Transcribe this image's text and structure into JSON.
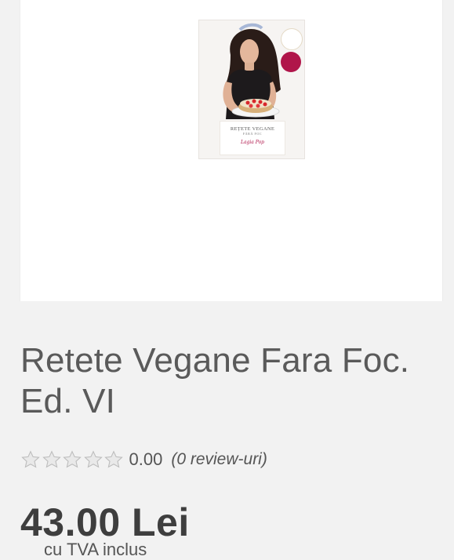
{
  "product": {
    "image": {
      "cover_title": "REȚETE VEGANE",
      "cover_subtitle": "FĂRĂ FOC",
      "cover_author": "Lagia Pop"
    },
    "title": "Retete Vegane Fara Foc. Ed. VI",
    "rating": {
      "stars_max": 5,
      "stars_filled": 0,
      "value": "0.00",
      "reviews_label": "(0 review-uri)"
    },
    "price": "43.00 Lei",
    "vat_note": "cu TVA inclus"
  },
  "colors": {
    "background": "#f2f2f2",
    "card": "#ffffff",
    "text": "#555555",
    "price": "#3e3e3e",
    "star_empty": "#e9e9e9",
    "star_outline": "#bdbdbd",
    "badge_red": "#b0154a"
  },
  "icons": {
    "rating": "star-outline-icon"
  }
}
